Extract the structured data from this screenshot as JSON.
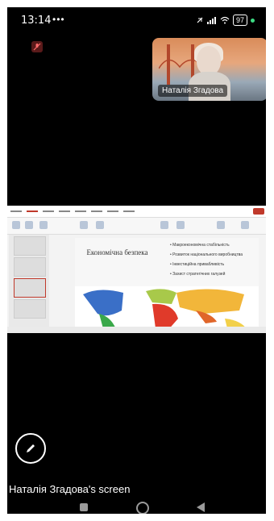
{
  "status_bar": {
    "time": "13:14",
    "icons_left": "•••",
    "battery": "97"
  },
  "pip": {
    "name": "Наталія Згадова"
  },
  "shared_slide": {
    "title": "Економічна безпека",
    "bullets": [
      "Макроекономічна стабільність",
      "Розвиток національного виробництва",
      "Інвестиційна привабливість",
      "Захист стратегічних галузей"
    ]
  },
  "footer": {
    "screen_label": "Наталія Згадова's screen"
  },
  "colors": {
    "accent": "#c0392b",
    "battery_green": "#3ddc84"
  },
  "icons": {
    "mic": "mic-off-icon",
    "pen": "pen-icon",
    "wifi": "wifi-icon",
    "signal": "signal-icon",
    "nav": [
      "square-nav-icon",
      "home-nav-icon",
      "back-nav-icon"
    ]
  }
}
